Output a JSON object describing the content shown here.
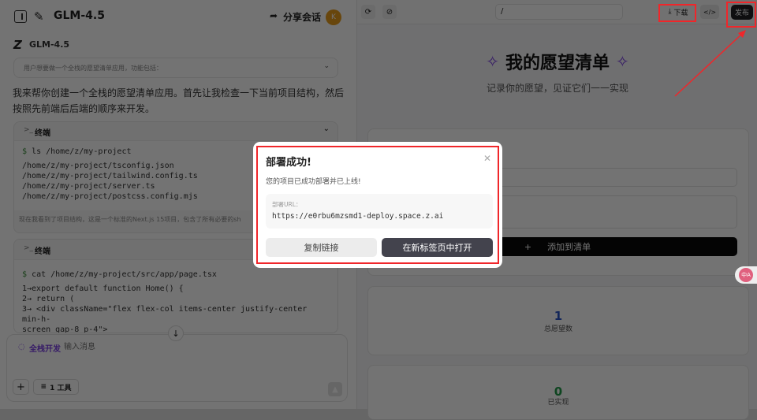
{
  "header": {
    "title": "GLM-4.5",
    "share_label": "分享会话",
    "avatar_letter": "K"
  },
  "chat": {
    "model_name": "GLM-4.5",
    "thinking_summary": "用户想要做一个全栈的愿望清单应用，功能包括：",
    "message": "我来帮你创建一个全栈的愿望清单应用。首先让我检查一下当前项目结构，然后按照先前端后后端的顺序来开发。",
    "terminal1": {
      "title": "终端",
      "command": "ls /home/z/my-project",
      "output": [
        "/home/z/my-project/tsconfig.json",
        "/home/z/my-project/tailwind.config.ts",
        "/home/z/my-project/server.ts",
        "/home/z/my-project/postcss.config.mjs"
      ],
      "note": "现在我看到了项目结构，这是一个标准的Next.js 15项目，包含了所有必要的sh"
    },
    "terminal2": {
      "title": "终端",
      "command": "cat /home/z/my-project/src/app/page.tsx",
      "output": [
        "1→export default function Home() {",
        "2→  return (",
        "3→    <div className=\"flex flex-col items-center justify-center min-h-",
        "screen gap-8 p-4\">"
      ]
    }
  },
  "composer": {
    "mode_label": "全栈开发",
    "placeholder": "输入消息",
    "tools_label": "1 工具"
  },
  "preview": {
    "url": "/",
    "download_label": "下载",
    "publish_label": "发布",
    "title": "我的愿望清单",
    "subtitle": "记录你的愿望，见证它们一一实现",
    "add_label": "添加到清单",
    "stats": [
      {
        "value": "1",
        "label": "总愿望数",
        "color": "#2b55c9"
      },
      {
        "value": "0",
        "label": "已实现",
        "color": "#1e9a48"
      }
    ]
  },
  "translate_badge": "中A",
  "modal": {
    "title": "部署成功!",
    "message": "您的项目已成功部署并已上线!",
    "url_label": "部署URL：",
    "url": "https://e0rbu6mzsmd1-deploy.space.z.ai",
    "copy_label": "复制链接",
    "open_label": "在新标签页中打开"
  },
  "colors": {
    "accent": "#7b3fe4",
    "annotation": "#f0262a"
  }
}
